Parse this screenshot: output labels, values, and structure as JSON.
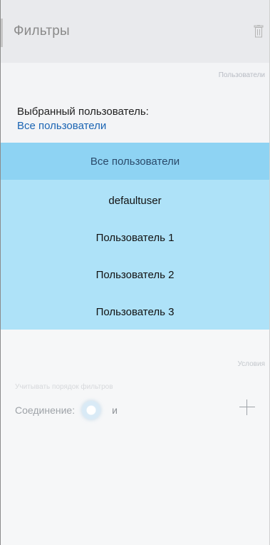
{
  "header": {
    "title": "Фильтры",
    "delete_icon": "trash-icon"
  },
  "users": {
    "section_label": "Пользователи",
    "selected_caption": "Выбранный пользователь:",
    "selected_value": "Все пользователи"
  },
  "dropdown": {
    "selected_index": 0,
    "options": [
      "Все пользователи",
      "defaultuser",
      "Пользователь 1",
      "Пользователь 2",
      "Пользователь 3"
    ]
  },
  "conditions": {
    "section_label": "Условия",
    "order_hint": "Учитывать порядок фильтров",
    "connection_label": "Соединение:",
    "connection_value": "и",
    "add_icon": "plus-icon"
  }
}
